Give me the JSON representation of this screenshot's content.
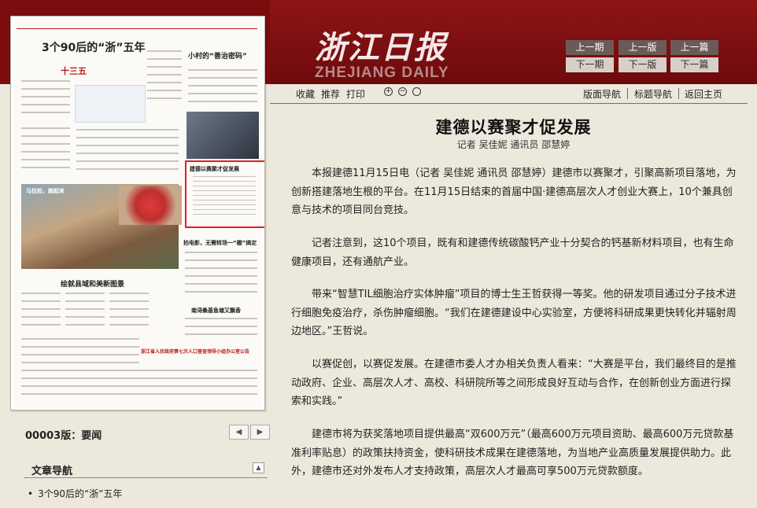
{
  "masthead": {
    "title_cn": "浙江日报",
    "title_en": "ZHEJIANG DAILY"
  },
  "nav_buttons": {
    "prev_issue": "上一期",
    "next_issue": "下一期",
    "prev_page": "上一版",
    "next_page": "下一版",
    "prev_article": "上一篇",
    "next_article": "下一篇"
  },
  "thumbnail": {
    "headline1": "3个90后的“浙”五年",
    "headline2": "小村的“善治密码”",
    "headline3": "建德以赛聚才促发展",
    "headline4": "绘就县域和美新图景",
    "headline5": "拍电影，无需转场一“棚”搞定",
    "headline6": "南浔桑基鱼塘又飘香",
    "headline7": "浙江省人民政府第七次人口普查领导小组办公室公告",
    "tag1": "十三五",
    "tag2": "马拉松，跑起来"
  },
  "page_info": {
    "label": "00003版：要闻",
    "prev_icon": "chevron-left-icon",
    "next_icon": "chevron-right-icon"
  },
  "article_nav": {
    "title": "文章导航",
    "items": [
      "3个90后的“浙”五年"
    ]
  },
  "toolbar": {
    "favorite": "收藏",
    "recommend": "推荐",
    "print": "打印",
    "layout_nav": "版面导航",
    "title_nav": "标题导航",
    "home": "返回主页"
  },
  "article": {
    "title": "建德以赛聚才促发展",
    "byline": "记者 吴佳妮 通讯员 邵慧婷",
    "paragraphs": [
      "本报建德11月15日电（记者 吴佳妮 通讯员 邵慧婷）建德市以赛聚才，引聚高新项目落地，为创新搭建落地生根的平台。在11月15日结束的首届中国·建德高层次人才创业大赛上，10个兼具创意与技术的项目同台竞技。",
      "记者注意到，这10个项目，既有和建德传统碳酸钙产业十分契合的钙基新材料项目，也有生命健康项目，还有通航产业。",
      "带来“智慧TIL细胞治疗实体肿瘤”项目的博士生王哲获得一等奖。他的研发项目通过分子技术进行细胞免疫治疗，杀伤肿瘤细胞。“我们在建德建设中心实验室，方便将科研成果更快转化并辐射周边地区。”王哲说。",
      "以赛促创，以赛促发展。在建德市委人才办相关负责人看来：“大赛是平台，我们最终目的是推动政府、企业、高层次人才、高校、科研院所等之间形成良好互动与合作，在创新创业方面进行探索和实践。”",
      "建德市将为获奖落地项目提供最高“双600万元”（最高600万元项目资助、最高600万元贷款基准利率贴息）的政策扶持资金，使科研技术成果在建德落地，为当地产业高质量发展提供助力。此外，建德市还对外发布人才支持政策，高层次人才最高可享500万元贷款额度。"
    ]
  },
  "colors": {
    "header_red": "#7b0d0f",
    "background": "#ece9dc",
    "highlight": "#e02020"
  }
}
